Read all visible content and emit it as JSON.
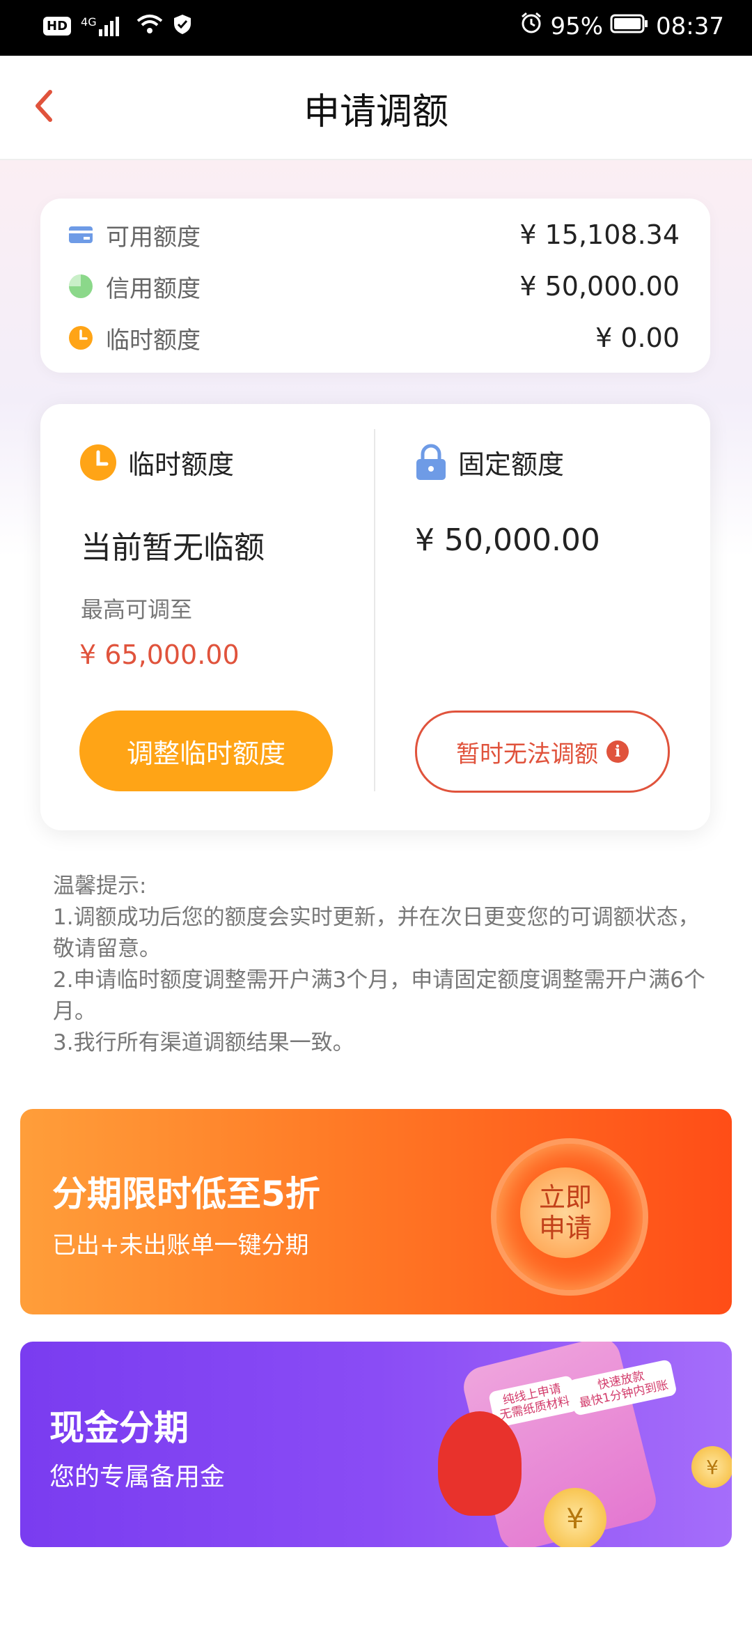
{
  "status_bar": {
    "hd": "HD",
    "signal": "4G",
    "battery": "95%",
    "time": "08:37"
  },
  "header": {
    "title": "申请调额"
  },
  "summary": [
    {
      "label": "可用额度",
      "amount": "¥ 15,108.34",
      "icon": "card-icon"
    },
    {
      "label": "信用额度",
      "amount": "¥ 50,000.00",
      "icon": "pie-icon"
    },
    {
      "label": "临时额度",
      "amount": "¥ 0.00",
      "icon": "clock-icon"
    }
  ],
  "temp": {
    "title": "临时额度",
    "status": "当前暂无临额",
    "max_label": "最高可调至",
    "max_amount": "¥ 65,000.00",
    "button": "调整临时额度"
  },
  "fixed": {
    "title": "固定额度",
    "amount": "¥ 50,000.00",
    "button": "暂时无法调额",
    "info": "i"
  },
  "tips": {
    "title": "温馨提示:",
    "items": [
      "1.调额成功后您的额度会实时更新，并在次日更变您的可调额状态，敬请留意。",
      "2.申请临时额度调整需开户满3个月，申请固定额度调整需开户满6个月。",
      "3.我行所有渠道调额结果一致。"
    ]
  },
  "banner_installment": {
    "title": "分期限时低至5折",
    "subtitle": "已出+未出账单一键分期",
    "cta_line1": "立即",
    "cta_line2": "申请"
  },
  "banner_cash": {
    "title": "现金分期",
    "subtitle": "您的专属备用金",
    "tag1_line1": "纯线上申请",
    "tag1_line2": "无需纸质材料",
    "tag2_line1": "快速放款",
    "tag2_line2": "最快1分钟内到账",
    "coin_symbol": "¥"
  },
  "colors": {
    "orange": "#ffa416",
    "red": "#e0533c",
    "purple": "#7a3cf0"
  }
}
